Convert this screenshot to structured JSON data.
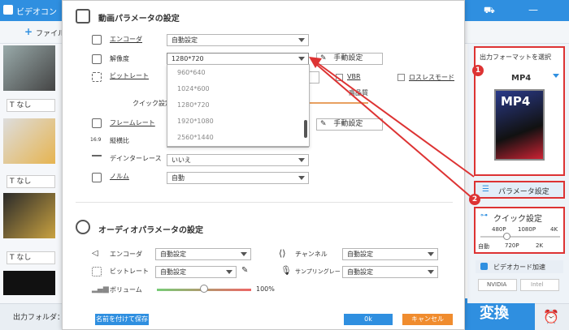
{
  "app": {
    "title": "ビデオコン",
    "add_file": "ファイル",
    "output_folder_label": "出力フォルダ：",
    "convert": "変換"
  },
  "thumbs": [
    {
      "caption": "なし"
    },
    {
      "caption": "なし"
    },
    {
      "caption": "なし"
    },
    {
      "caption": "なし"
    }
  ],
  "right": {
    "select_format": "出力フォーマットを選択",
    "format": "MP4",
    "format_icon_text": "MP4",
    "param_settings": "パラメータ設定",
    "quick_settings": "クイック設定",
    "quick_top": [
      "480P",
      "1080P",
      "4K"
    ],
    "quick_bottom": [
      "自動",
      "720P",
      "2K"
    ],
    "gpu_accel": "ビデオカード加速",
    "nvidia": "NVIDIA",
    "intel": "Intel",
    "badge1": "1",
    "badge2": "2"
  },
  "dialog": {
    "video_title": "動画パラメータの設定",
    "encoder_label": "エンコーダ",
    "encoder_value": "自動設定",
    "resolution_label": "解像度",
    "resolution_value": "1280*720",
    "manual_label": "手動設定",
    "bitrate_label": "ビットレート",
    "vbr": "VBR",
    "lossless": "ロスレスモード",
    "quick_setting_label": "クイック設定",
    "quality": "高品質",
    "framerate_label": "フレームレート",
    "aspect_label": "縦横比",
    "aspect_value": "自動",
    "deinterlace_label": "デインターレース",
    "deinterlace_value": "いいえ",
    "norm_label": "ノルム",
    "norm_value": "自動",
    "dropdown": [
      "960*640",
      "1024*600",
      "1280*720",
      "1920*1080",
      "2560*1440"
    ],
    "audio_title": "オーディオパラメータの設定",
    "a_encoder_label": "エンコーダ",
    "a_encoder_value": "自動設定",
    "a_bitrate_label": "ビットレート",
    "a_bitrate_value": "自動設定",
    "channel_label": "チャンネル",
    "channel_value": "自動設定",
    "samplerate_label": "サンプリングレート",
    "samplerate_value": "自動設定",
    "volume_label": "ボリューム",
    "volume_value": "100%",
    "volume_level": 0.5,
    "save_as": "名前を付けて保存",
    "ok": "0k",
    "cancel": "キャンセル"
  }
}
